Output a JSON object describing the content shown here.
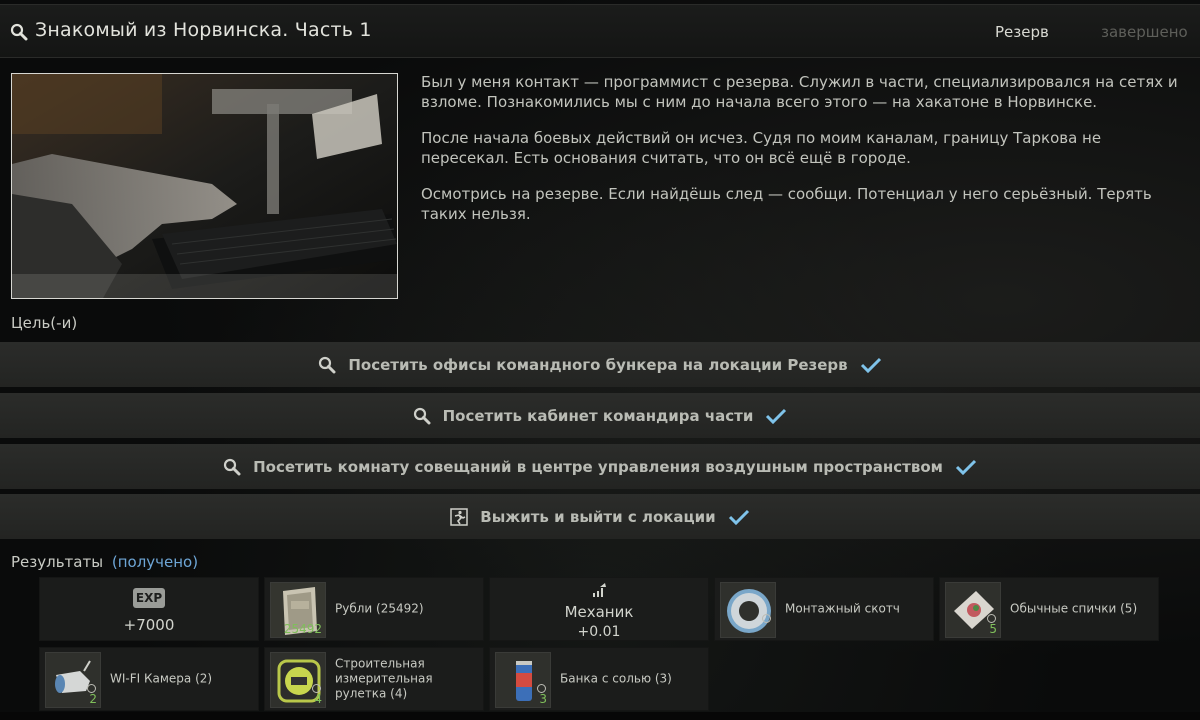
{
  "header": {
    "title": "Знакомый из Норвинска. Часть 1",
    "location": "Резерв",
    "status": "завершено"
  },
  "description": {
    "paragraphs": [
      "Был у меня контакт — программист с резерва. Служил в части, специализировался на сетях и взломе. Познакомились мы с ним до начала всего этого — на хакатоне в Норвинске.",
      "После начала боевых действий он исчез. Судя по моим каналам, границу Таркова не пересекал. Есть основания считать, что он всё ещё в городе.",
      "Осмотрись на резерве. Если найдёшь след — сообщи. Потенциал у него серьёзный. Терять таких нельзя."
    ]
  },
  "goals_label": "Цель(-и)",
  "objectives": [
    {
      "label": "Посетить офисы командного бункера на локации Резерв",
      "icon": "search-icon",
      "completed": true
    },
    {
      "label": "Посетить кабинет командира части",
      "icon": "search-icon",
      "completed": true
    },
    {
      "label": "Посетить комнату совещаний в центре управления воздушным пространством",
      "icon": "search-icon",
      "completed": true
    },
    {
      "label": "Выжить и выйти с локации",
      "icon": "exit-icon",
      "completed": true
    }
  ],
  "results": {
    "label": "Результаты",
    "received": "(получено)",
    "exp": {
      "badge": "EXP",
      "value": "+7000"
    },
    "roubles": {
      "name": "Рубли (25492)",
      "qty": "25492"
    },
    "trader": {
      "name": "Механик",
      "value": "+0.01"
    },
    "items": [
      {
        "key": "tape",
        "name": "Монтажный скотч",
        "qty": ""
      },
      {
        "key": "matches",
        "name": "Обычные спички (5)",
        "qty": "5"
      },
      {
        "key": "camera",
        "name": "WI-FI Камера (2)",
        "qty": "2"
      },
      {
        "key": "ruler",
        "name": "Строительная измерительная рулетка (4)",
        "qty": "4"
      },
      {
        "key": "salt",
        "name": "Банка с солью (3)",
        "qty": "3"
      }
    ]
  },
  "colors": {
    "accent_check": "#7fc3ea",
    "received": "#6ea6d6",
    "qty_green": "#7fbf5a"
  }
}
